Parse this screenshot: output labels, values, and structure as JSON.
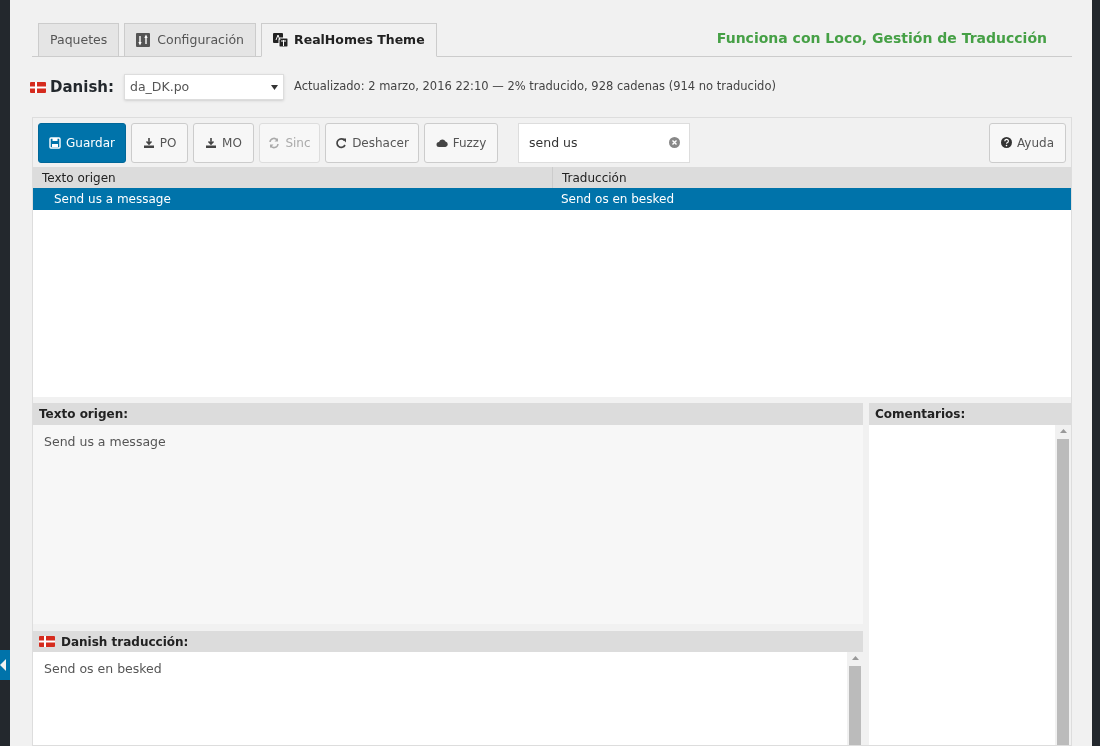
{
  "tabs": [
    {
      "label": "Paquetes",
      "selected": false
    },
    {
      "label": "Configuración",
      "selected": false
    },
    {
      "label": "RealHomes Theme",
      "selected": true
    }
  ],
  "powered_by": "Funciona con Loco, Gestión de Traducción",
  "locale": {
    "language": "Danish:",
    "file": "da_DK.po",
    "meta": "Actualizado: 2 marzo, 2016 22:10 — 2% traducido, 928 cadenas (914 no traducido)"
  },
  "toolbar": {
    "buttons": [
      {
        "label": "Guardar",
        "primary": true,
        "disabled": false
      },
      {
        "label": "PO",
        "primary": false,
        "disabled": false
      },
      {
        "label": "MO",
        "primary": false,
        "disabled": false
      },
      {
        "label": "Sinc",
        "primary": false,
        "disabled": true
      },
      {
        "label": "Deshacer",
        "primary": false,
        "disabled": false
      },
      {
        "label": "Fuzzy",
        "primary": false,
        "disabled": false
      }
    ],
    "search": {
      "value": "send us"
    },
    "help": "Ayuda"
  },
  "table": {
    "columns": [
      "Texto origen",
      "Traducción"
    ],
    "rows": [
      {
        "source": "Send us a message",
        "translation": "Send os en besked",
        "selected": true
      }
    ]
  },
  "source_panel": {
    "title": "Texto origen:",
    "text": "Send us a message"
  },
  "translation_panel": {
    "title": "Danish traducción:",
    "text": "Send os en besked"
  },
  "comments_panel": {
    "title": "Comentarios:"
  }
}
